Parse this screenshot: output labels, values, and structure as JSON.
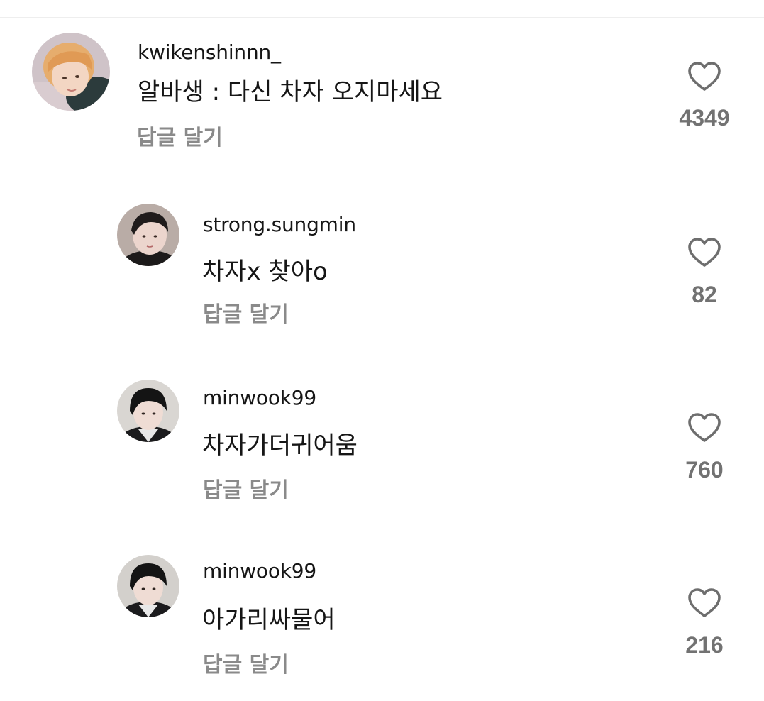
{
  "comments": [
    {
      "username": "kwikenshinnn_",
      "text": "알바생 : 다신 차자 오지마세요",
      "reply_label": "답글 달기",
      "likes": "4349"
    },
    {
      "username": "strong.sungmin",
      "text": "차자x 찾아o",
      "reply_label": "답글 달기",
      "likes": "82"
    },
    {
      "username": "minwook99",
      "text": "차자가더귀어움",
      "reply_label": "답글 달기",
      "likes": "760"
    },
    {
      "username": "minwook99",
      "text": "아가리싸물어",
      "reply_label": "답글 달기",
      "likes": "216"
    }
  ],
  "icons": {
    "like": "heart-outline-icon"
  },
  "colors": {
    "username": "#161616",
    "reply": "#8a8a8a",
    "like_count": "#727272",
    "heart_stroke": "#6e6e6e"
  }
}
